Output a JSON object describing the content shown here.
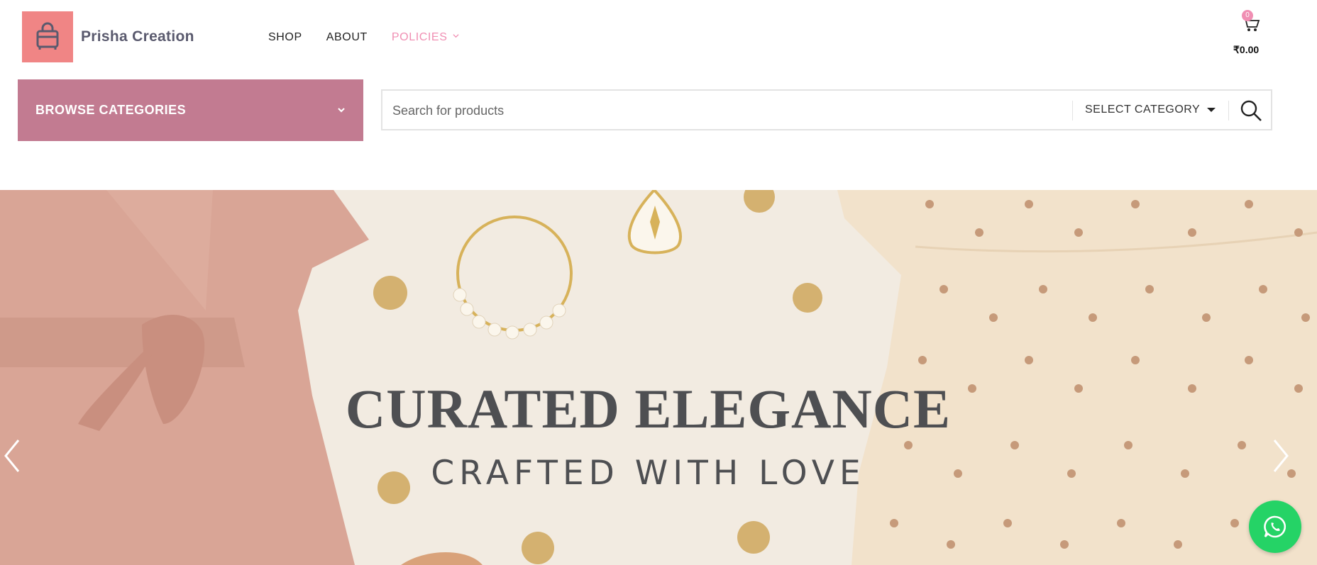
{
  "brand": {
    "name": "Prisha Creation",
    "logo_icon": "shopping-bag-icon",
    "logo_color": "#f08585"
  },
  "nav": {
    "items": [
      {
        "label": "SHOP"
      },
      {
        "label": "ABOUT"
      },
      {
        "label": "POLICIES"
      }
    ],
    "active_color": "#f08fb3"
  },
  "cart": {
    "count": "0",
    "total": "₹0.00",
    "icon": "cart-icon"
  },
  "browse": {
    "label": "BROWSE CATEGORIES",
    "color": "#c27b91"
  },
  "search": {
    "placeholder": "Search for products",
    "category_label": "SELECT CATEGORY",
    "icon": "search-icon"
  },
  "hero": {
    "title": "CURATED ELEGANCE",
    "subtitle": "CRAFTED WITH LOVE"
  },
  "whatsapp": {
    "icon": "whatsapp-icon",
    "color": "#25d366"
  }
}
